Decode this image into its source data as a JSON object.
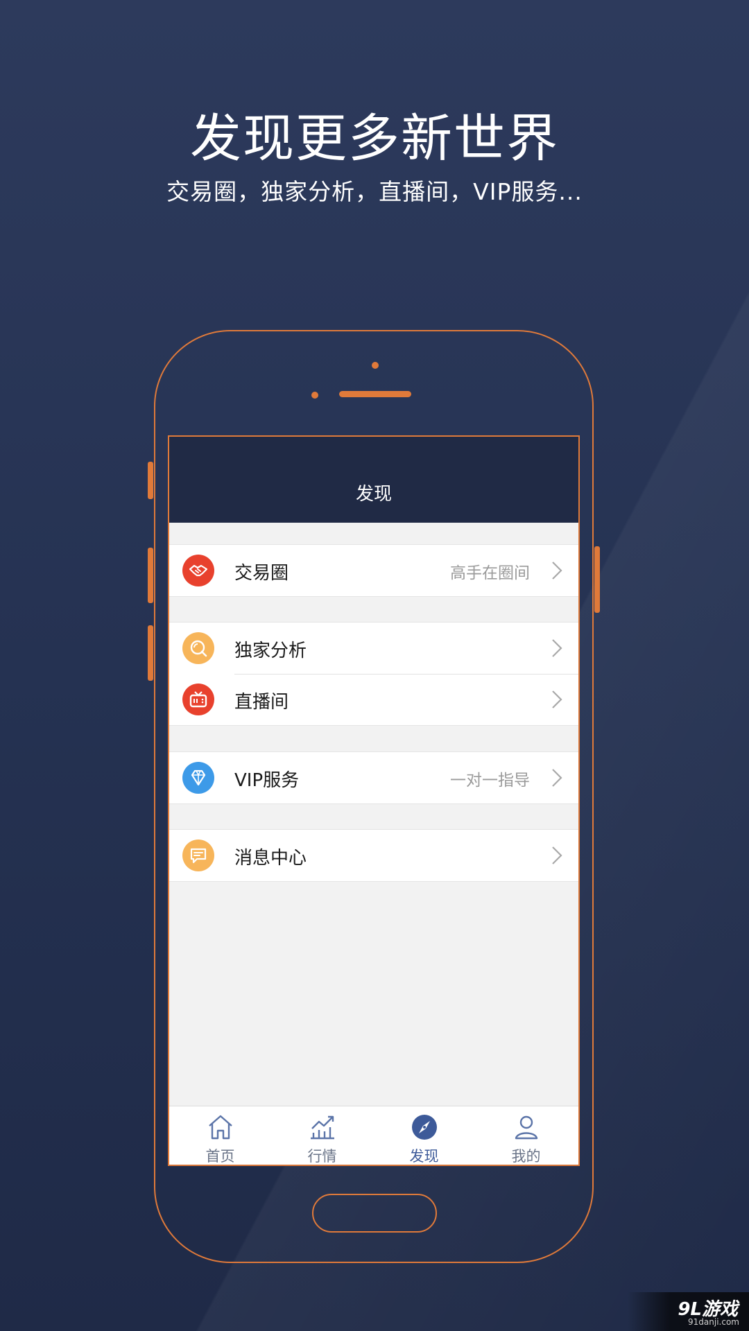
{
  "headline": "发现更多新世界",
  "subline": "交易圈，独家分析，直播间，VIP服务...",
  "colors": {
    "frame_accent": "#e07a3a",
    "nav_bg": "#202a45",
    "active_tab": "#3d5a99"
  },
  "screen": {
    "nav_title": "发现",
    "groups": [
      {
        "items": [
          {
            "label": "交易圈",
            "hint": "高手在圈间",
            "icon": "handshake-icon",
            "icon_color": "#e8412d"
          }
        ]
      },
      {
        "items": [
          {
            "label": "独家分析",
            "hint": "",
            "icon": "magnifier-icon",
            "icon_color": "#f7b55a"
          },
          {
            "label": "直播间",
            "hint": "",
            "icon": "tv-icon",
            "icon_color": "#e8412d"
          }
        ]
      },
      {
        "items": [
          {
            "label": "VIP服务",
            "hint": "一对一指导",
            "icon": "diamond-icon",
            "icon_color": "#3d9ae8"
          }
        ]
      },
      {
        "items": [
          {
            "label": "消息中心",
            "hint": "",
            "icon": "chat-icon",
            "icon_color": "#f7b55a"
          }
        ]
      }
    ],
    "tabs": [
      {
        "label": "首页",
        "icon": "home-icon",
        "active": false
      },
      {
        "label": "行情",
        "icon": "chart-icon",
        "active": false
      },
      {
        "label": "发现",
        "icon": "compass-icon",
        "active": true
      },
      {
        "label": "我的",
        "icon": "user-icon",
        "active": false
      }
    ]
  },
  "watermark": {
    "logo": "9L游戏",
    "site": "91danji.com"
  }
}
